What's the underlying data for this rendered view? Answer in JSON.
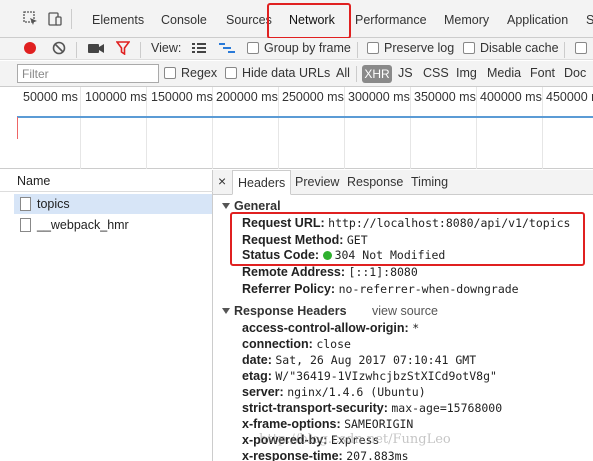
{
  "tabs": [
    "Elements",
    "Console",
    "Sources",
    "Network",
    "Performance",
    "Memory",
    "Application",
    "S"
  ],
  "active_tab": "Network",
  "toolbar": {
    "view_label": "View:",
    "group_by_frame": "Group by frame",
    "preserve_log": "Preserve log",
    "disable_cache": "Disable cache"
  },
  "filter": {
    "placeholder": "Filter",
    "regex": "Regex",
    "hide_data_urls": "Hide data URLs",
    "types": [
      "All",
      "XHR",
      "JS",
      "CSS",
      "Img",
      "Media",
      "Font",
      "Doc"
    ],
    "active_type": "XHR"
  },
  "timeline_ticks": [
    "50000 ms",
    "100000 ms",
    "150000 ms",
    "200000 ms",
    "250000 ms",
    "300000 ms",
    "350000 ms",
    "400000 ms",
    "450000 r"
  ],
  "requests": {
    "header": "Name",
    "items": [
      "topics",
      "__webpack_hmr"
    ]
  },
  "detail_tabs": {
    "close": "×",
    "items": [
      "Headers",
      "Preview",
      "Response",
      "Timing"
    ],
    "active": "Headers"
  },
  "general": {
    "title": "General",
    "request_url_k": "Request URL:",
    "request_url_v": "http://localhost:8080/api/v1/topics",
    "request_method_k": "Request Method:",
    "request_method_v": "GET",
    "status_code_k": "Status Code:",
    "status_code_v": "304 Not Modified",
    "remote_address_k": "Remote Address:",
    "remote_address_v": "[::1]:8080",
    "referrer_policy_k": "Referrer Policy:",
    "referrer_policy_v": "no-referrer-when-downgrade"
  },
  "response_headers": {
    "title": "Response Headers",
    "view_source": "view source",
    "items": [
      {
        "k": "access-control-allow-origin:",
        "v": "*"
      },
      {
        "k": "connection:",
        "v": "close"
      },
      {
        "k": "date:",
        "v": "Sat, 26 Aug 2017 07:10:41 GMT"
      },
      {
        "k": "etag:",
        "v": "W/\"36419-1VIzwhcjbzStXICd9otV8g\""
      },
      {
        "k": "server:",
        "v": "nginx/1.4.6 (Ubuntu)"
      },
      {
        "k": "strict-transport-security:",
        "v": "max-age=15768000"
      },
      {
        "k": "x-frame-options:",
        "v": "SAMEORIGIN"
      },
      {
        "k": "x-powered-by:",
        "v": "Express"
      },
      {
        "k": "x-response-time:",
        "v": "207.883ms"
      }
    ]
  },
  "watermark": "http://blog.csdn.net/FungLeo",
  "colors": {
    "highlight": "#e02020",
    "status_ok": "#2fb02f",
    "record": "#e02020",
    "selected_row": "#d7e5f7"
  }
}
